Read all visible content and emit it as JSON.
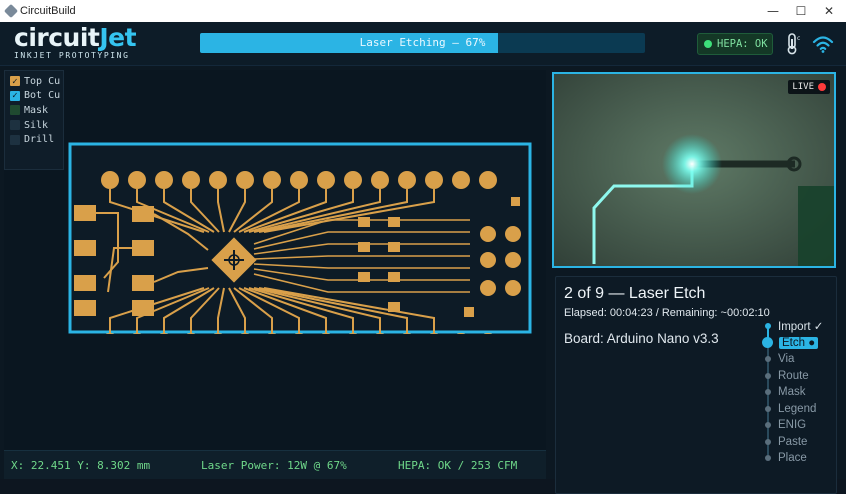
{
  "window": {
    "title": "CircuitBuild",
    "minimize": "—",
    "maximize": "☐",
    "close": "✕"
  },
  "logo": {
    "word_a": "circuit",
    "word_b": "Jet",
    "tagline": "INKJET PROTOTYPING"
  },
  "progress": {
    "label": "Laser Etching — 67%",
    "value": 0.67
  },
  "hepa_button": {
    "label": "HEPA: OK",
    "icon": "status-dot"
  },
  "header_icons": [
    "thermometer-icon",
    "wifi-icon"
  ],
  "layers": [
    {
      "label": "Top Cu",
      "checked": true,
      "color": "#d9a04a"
    },
    {
      "label": "Bot Cu",
      "checked": true,
      "color": "#2bb4e4"
    },
    {
      "label": "Mask",
      "checked": false,
      "color": "#1f4a30"
    },
    {
      "label": "Silk",
      "checked": false,
      "color": "#1d3140"
    },
    {
      "label": "Drill",
      "checked": false,
      "color": "#1d3140"
    }
  ],
  "camera": {
    "live_label": "LIVE"
  },
  "job": {
    "step_title": "2 of 9 — Laser Etch",
    "elapsed": "Elapsed: 00:04:23 / Remaining: ~00:02:10",
    "board": "Board: Arduino Nano v3.3",
    "steps": [
      {
        "label": "Import ✓",
        "state": "done"
      },
      {
        "label": "Etch ●",
        "state": "active"
      },
      {
        "label": "Via",
        "state": "pending"
      },
      {
        "label": "Route",
        "state": "pending"
      },
      {
        "label": "Mask",
        "state": "pending"
      },
      {
        "label": "Legend",
        "state": "pending"
      },
      {
        "label": "ENIG",
        "state": "pending"
      },
      {
        "label": "Paste",
        "state": "pending"
      },
      {
        "label": "Place",
        "state": "pending"
      }
    ]
  },
  "status": {
    "coords": "X: 22.451 Y: 8.302 mm",
    "laser": "Laser Power: 12W @ 67%",
    "hepa": "HEPA: OK / 253 CFM"
  },
  "colors": {
    "accent": "#2bb4e4",
    "copper": "#d9a04a",
    "ok_green": "#6fd88a",
    "background": "#0c1822"
  }
}
